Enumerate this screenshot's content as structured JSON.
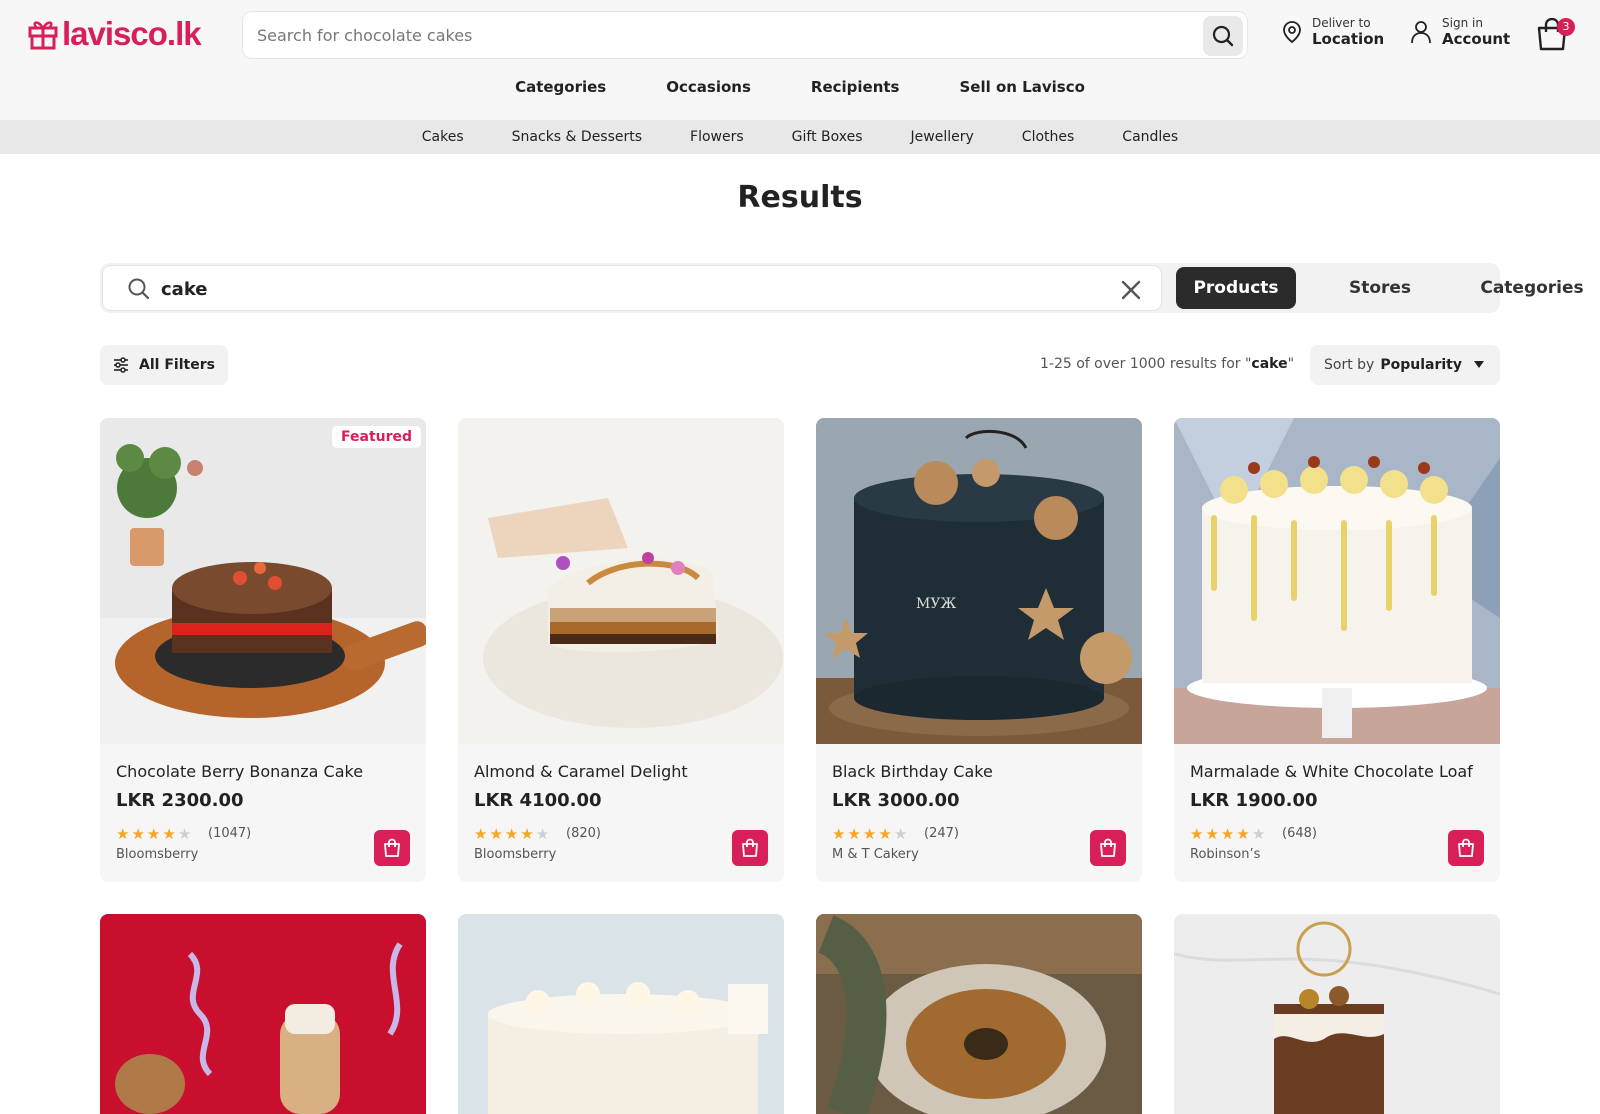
{
  "header": {
    "logo": "lavisco.lk",
    "search_placeholder": "Search for chocolate cakes",
    "deliver_small": "Deliver to",
    "deliver_big": "Location",
    "signin_small": "Sign in",
    "signin_big": "Account",
    "cart_count": "3"
  },
  "main_nav": [
    "Categories",
    "Occasions",
    "Recipients",
    "Sell on Lavisco"
  ],
  "sub_nav": [
    "Cakes",
    "Snacks & Desserts",
    "Flowers",
    "Gift Boxes",
    "Jewellery",
    "Clothes",
    "Candles"
  ],
  "page_title": "Results",
  "results_search": {
    "query": "cake",
    "tabs": [
      "Products",
      "Stores",
      "Categories"
    ],
    "active_tab": "Products"
  },
  "toolbar": {
    "filters_label": "All Filters",
    "results_prefix": "1-25 of over 1000 results for \"",
    "results_query": "cake",
    "results_suffix": "\"",
    "sort_label": "Sort by",
    "sort_value": "Popularity"
  },
  "products": [
    {
      "name": "Chocolate Berry Bonanza Cake",
      "price": "LKR 2300.00",
      "rating": 4,
      "reviews": "(1047)",
      "store": "Bloomsberry",
      "badge": "Featured"
    },
    {
      "name": "Almond & Caramel Delight",
      "price": "LKR 4100.00",
      "rating": 4,
      "reviews": "(820)",
      "store": "Bloomsberry"
    },
    {
      "name": "Black Birthday Cake",
      "price": "LKR 3000.00",
      "rating": 4,
      "reviews": "(247)",
      "store": "M & T Cakery"
    },
    {
      "name": "Marmalade & White Chocolate Loaf",
      "price": "LKR 1900.00",
      "rating": 4,
      "reviews": "(648)",
      "store": "Robinson’s"
    }
  ],
  "colors": {
    "brand": "#d81f57",
    "dark": "#2b2b2b",
    "star": "#f5a623"
  }
}
